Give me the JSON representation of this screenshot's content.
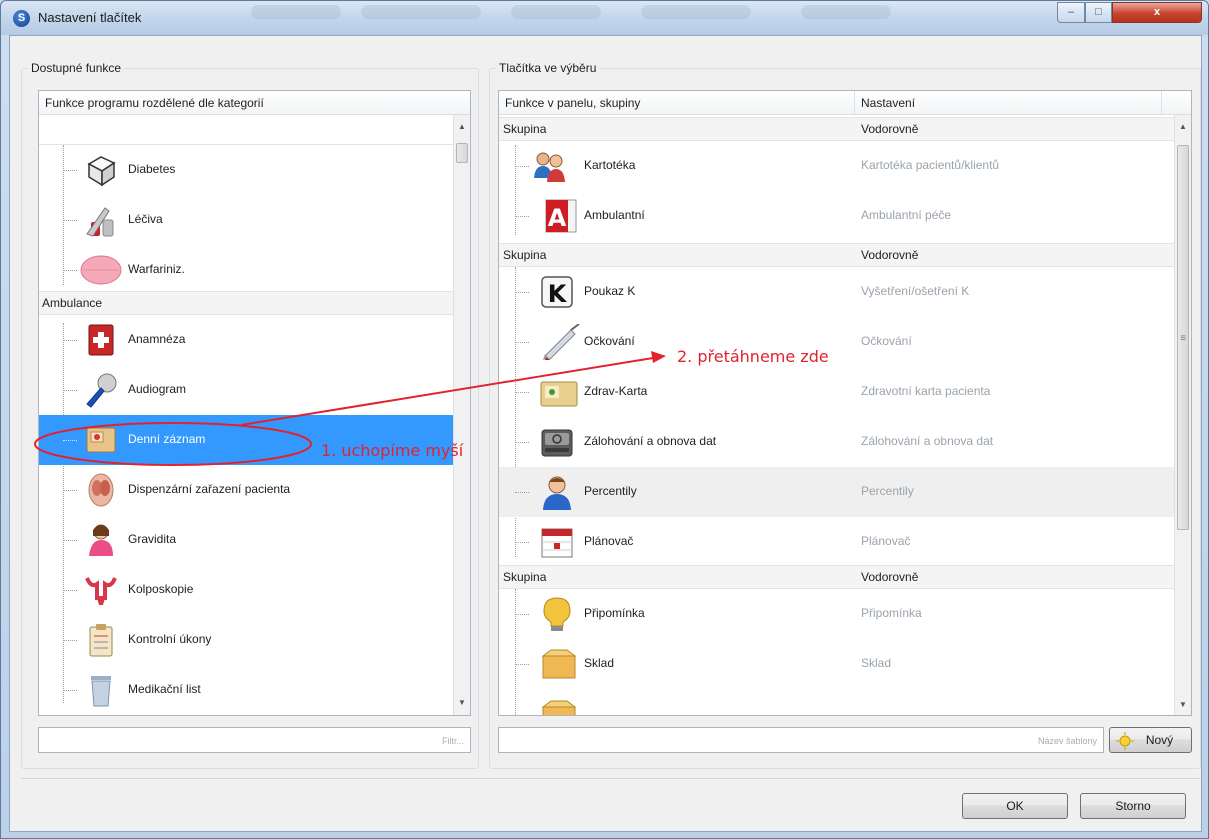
{
  "window": {
    "app_icon_glyph": "S",
    "title": "Nastavení tlačítek",
    "controls": {
      "minimize": "–",
      "maximize": "□",
      "close": "x"
    }
  },
  "left": {
    "legend": "Dostupné funkce",
    "header": "Funkce programu rozdělené dle kategorií",
    "items_top": [
      {
        "label": "Diabetes",
        "icon": "dice-icon"
      },
      {
        "label": "Léčiva",
        "icon": "medicine-icon"
      },
      {
        "label": "Warfariniz.",
        "icon": "pill-icon"
      }
    ],
    "group": "Ambulance",
    "items": [
      {
        "label": "Anamnéza",
        "icon": "first-aid-book-icon"
      },
      {
        "label": "Audiogram",
        "icon": "microphone-icon"
      },
      {
        "label": "Denní záznam",
        "icon": "daily-record-icon",
        "selected": true
      },
      {
        "label": "Dispenzární zařazení pacienta",
        "icon": "anatomy-icon"
      },
      {
        "label": "Gravidita",
        "icon": "pregnant-woman-icon"
      },
      {
        "label": "Kolposkopie",
        "icon": "uterus-icon"
      },
      {
        "label": "Kontrolní úkony",
        "icon": "clipboard-icon"
      },
      {
        "label": "Medikační list",
        "icon": "trash-bin-icon"
      }
    ],
    "filter_placeholder": "Filtr..."
  },
  "right": {
    "legend": "Tlačítka ve výběru",
    "col1": "Funkce v panelu, skupiny",
    "col2": "Nastavení",
    "groups": [
      {
        "name": "Skupina",
        "setting": "Vodorovně",
        "items": [
          {
            "label": "Kartotéka",
            "setting": "Kartotéka pacientů/klientů",
            "icon": "people-icon"
          },
          {
            "label": "Ambulantní",
            "setting": "Ambulantní péče",
            "icon": "letter-a-icon"
          }
        ]
      },
      {
        "name": "Skupina",
        "setting": "Vodorovně",
        "items": [
          {
            "label": "Poukaz K",
            "setting": "Vyšetření/ošetření K",
            "icon": "letter-k-icon"
          },
          {
            "label": "Očkování",
            "setting": "Očkování",
            "icon": "syringe-icon"
          },
          {
            "label": "Zdrav-Karta",
            "setting": "Zdravotní karta pacienta",
            "icon": "health-card-icon"
          },
          {
            "label": "Zálohování a obnova dat",
            "setting": "Zálohování a obnova dat",
            "icon": "hard-drive-icon"
          },
          {
            "label": "Percentily",
            "setting": "Percentily",
            "icon": "person-icon"
          },
          {
            "label": "Plánovač",
            "setting": "Plánovač",
            "icon": "calendar-icon"
          }
        ]
      },
      {
        "name": "Skupina",
        "setting": "Vodorovně",
        "items": [
          {
            "label": "Připomínka",
            "setting": "Připomínka",
            "icon": "lightbulb-icon"
          },
          {
            "label": "Sklad",
            "setting": "Sklad",
            "icon": "box-icon"
          }
        ]
      }
    ],
    "template_placeholder": "Název šablony",
    "new_button": "Nový"
  },
  "annotations": {
    "step1": "1. uchopíme myší",
    "step2": "2. přetáhneme zde",
    "color": "#e0232f"
  },
  "buttons": {
    "ok": "OK",
    "cancel": "Storno"
  },
  "colors": {
    "selection": "#3399ff",
    "title_bar": "#c5d7ec"
  }
}
